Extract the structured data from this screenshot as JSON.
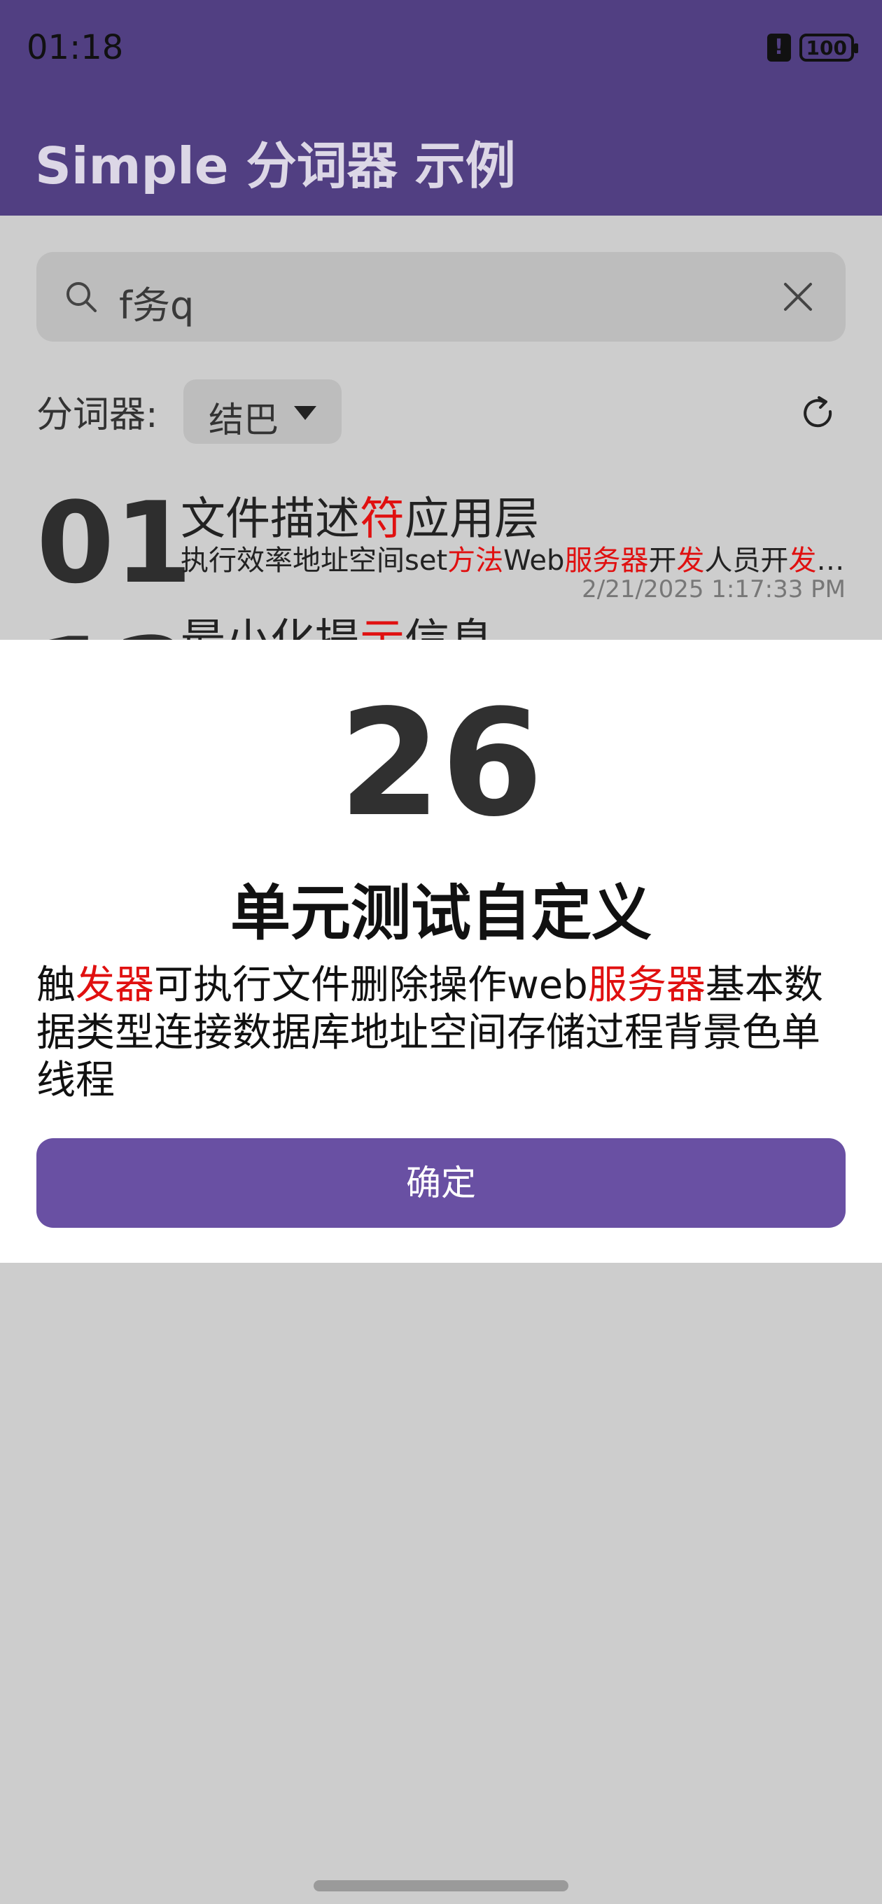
{
  "status": {
    "time": "01:18",
    "battery": "100"
  },
  "app": {
    "title": "Simple 分词器 示例"
  },
  "search": {
    "value": "f务q"
  },
  "segmenter": {
    "label": "分词器:",
    "selected": "结巴"
  },
  "list": [
    {
      "num": "01",
      "title_parts": [
        {
          "text": "文件描述",
          "hl": false
        },
        {
          "text": "符",
          "hl": true
        },
        {
          "text": "应用层",
          "hl": false
        }
      ],
      "desc_parts": [
        {
          "text": "执行效率地址空间set",
          "hl": false
        },
        {
          "text": "方法",
          "hl": true
        },
        {
          "text": "Web",
          "hl": false
        },
        {
          "text": "服务器",
          "hl": true
        },
        {
          "text": "开",
          "hl": false
        },
        {
          "text": "发",
          "hl": true
        },
        {
          "text": "人员开",
          "hl": false
        },
        {
          "text": "发",
          "hl": true
        },
        {
          "text": "者...",
          "hl": false
        }
      ],
      "time": "2/21/2025  1:17:33 PM"
    },
    {
      "num": "12",
      "title_parts": [
        {
          "text": "最小化提",
          "hl": false
        },
        {
          "text": "示",
          "hl": true
        },
        {
          "text": "信息",
          "hl": false
        }
      ]
    }
  ],
  "dialog": {
    "number": "26",
    "title": "单元测试自定义",
    "body_parts": [
      {
        "text": "触",
        "hl": false
      },
      {
        "text": "发器",
        "hl": true
      },
      {
        "text": "可执行文件删除操作web",
        "hl": false
      },
      {
        "text": "服务器",
        "hl": true
      },
      {
        "text": "基本数据类型连接数据库地址空间存储过程背景色单线程",
        "hl": false
      }
    ],
    "button": "确定"
  },
  "colors": {
    "primary": "#513f82",
    "button": "#6950a3",
    "highlight": "#e01010"
  }
}
